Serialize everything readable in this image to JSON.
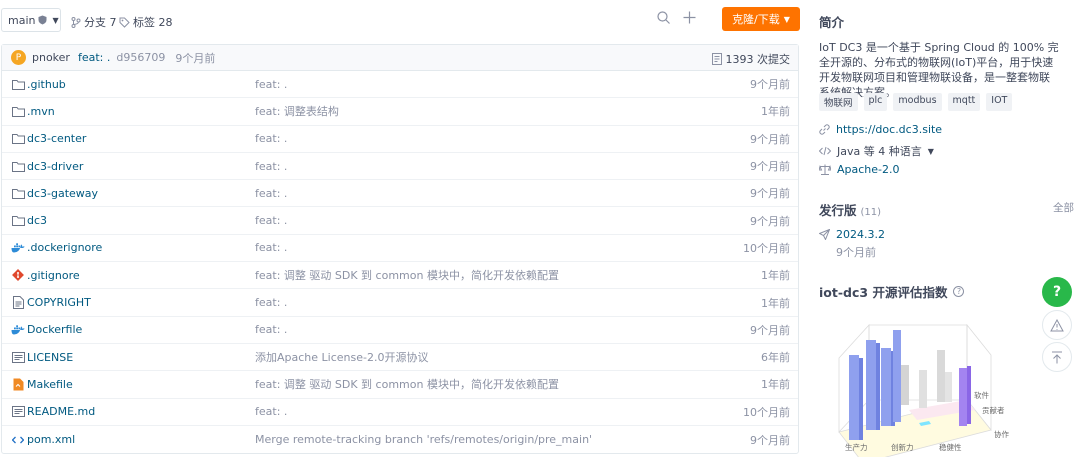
{
  "toolbar": {
    "branch": "main",
    "branches_label": "分支 7",
    "tags_label": "标签 28",
    "clone_label": "克隆/下载"
  },
  "commit": {
    "avatar_letter": "P",
    "author": "pnoker",
    "message": "feat: .",
    "hash": "d956709",
    "time": "9个月前",
    "count_label": "1393 次提交"
  },
  "files": [
    {
      "icon": "folder-icon",
      "name": ".github",
      "message": "feat: .",
      "time": "9个月前"
    },
    {
      "icon": "folder-icon",
      "name": ".mvn",
      "message": "feat: 调整表结构",
      "time": "1年前"
    },
    {
      "icon": "folder-icon",
      "name": "dc3-center",
      "message": "feat: .",
      "time": "9个月前"
    },
    {
      "icon": "folder-icon",
      "name": "dc3-driver",
      "message": "feat: .",
      "time": "9个月前"
    },
    {
      "icon": "folder-icon",
      "name": "dc3-gateway",
      "message": "feat: .",
      "time": "9个月前"
    },
    {
      "icon": "folder-icon",
      "name": "dc3",
      "message": "feat: .",
      "time": "9个月前"
    },
    {
      "icon": "docker-icon",
      "name": ".dockerignore",
      "message": "feat: .",
      "time": "10个月前"
    },
    {
      "icon": "git-icon",
      "name": ".gitignore",
      "message": "feat: 调整 驱动 SDK 到 common 模块中，简化开发依赖配置",
      "time": "1年前"
    },
    {
      "icon": "file-icon",
      "name": "COPYRIGHT",
      "message": "feat: .",
      "time": "1年前"
    },
    {
      "icon": "docker-icon",
      "name": "Dockerfile",
      "message": "feat: .",
      "time": "9个月前"
    },
    {
      "icon": "license-icon",
      "name": "LICENSE",
      "message": "添加Apache License-2.0开源协议",
      "time": "6年前"
    },
    {
      "icon": "makefile-icon",
      "name": "Makefile",
      "message": "feat: 调整 驱动 SDK 到 common 模块中，简化开发依赖配置",
      "time": "1年前"
    },
    {
      "icon": "readme-icon",
      "name": "README.md",
      "message": "feat: .",
      "time": "10个月前"
    },
    {
      "icon": "code-icon",
      "name": "pom.xml",
      "message": "Merge remote-tracking branch 'refs/remotes/origin/pre_main'",
      "time": "9个月前"
    }
  ],
  "sidebar": {
    "intro_title": "简介",
    "description": "IoT DC3 是一个基于 Spring Cloud 的 100% 完全开源的、分布式的物联网(IoT)平台，用于快速开发物联网项目和管理物联设备，是一整套物联系统解决方案。",
    "tags": [
      "物联网",
      "plc",
      "modbus",
      "mqtt",
      "IOT"
    ],
    "website": "https://doc.dc3.site",
    "languages": "Java 等 4 种语言",
    "license": "Apache-2.0",
    "releases_title": "发行版",
    "releases_count": "(11)",
    "releases_all": "全部",
    "release_version": "2024.3.2",
    "release_time": "9个月前",
    "eval_title": "iot-dc3 开源评估指数"
  },
  "chart_data": {
    "type": "bar",
    "title": "iot-dc3 开源评估指数",
    "axis_labels": [
      "生产力",
      "创新力",
      "稳健性",
      "软件",
      "贡献者",
      "协作"
    ]
  }
}
